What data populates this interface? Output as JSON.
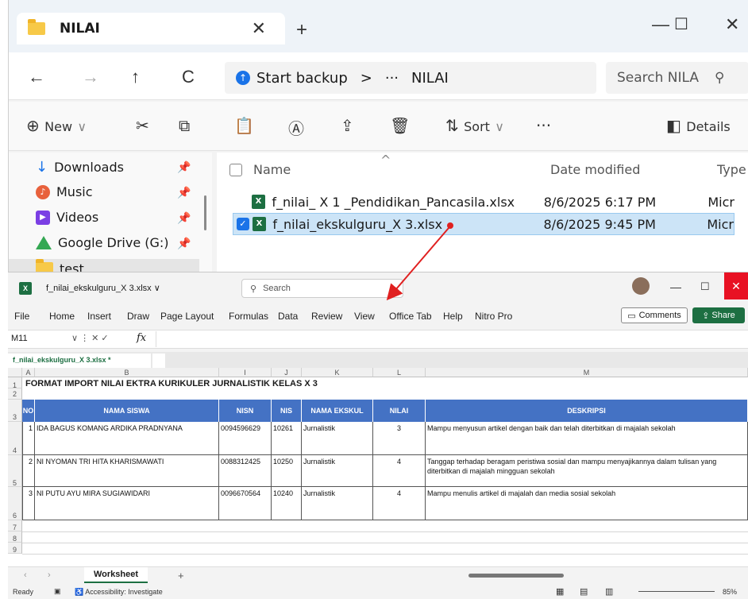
{
  "explorer": {
    "tab_title": "NILAI",
    "tab_close": "✕",
    "new_tab": "+",
    "window_controls": {
      "minimize": "—",
      "maximize": "☐",
      "close": "✕"
    },
    "nav": {
      "back": "←",
      "forward": "→",
      "up": "↑",
      "refresh": "C"
    },
    "address": {
      "backup_label": "Start backup",
      "sep": ">",
      "more": "···",
      "folder": "NILAI"
    },
    "search": {
      "placeholder": "Search NILA",
      "icon": "search-icon"
    },
    "toolbar": {
      "new_label": "New",
      "sort_label": "Sort",
      "more": "···",
      "details_label": "Details"
    },
    "sidebar": {
      "items": [
        {
          "label": "Downloads",
          "icon": "download-icon"
        },
        {
          "label": "Music",
          "icon": "music-icon"
        },
        {
          "label": "Videos",
          "icon": "video-icon"
        },
        {
          "label": "Google Drive (G:)",
          "icon": "google-drive-icon"
        },
        {
          "label": "test",
          "icon": "folder-icon"
        }
      ]
    },
    "columns": {
      "name": "Name",
      "date": "Date modified",
      "type": "Type"
    },
    "files": [
      {
        "name": "f_nilai_ X 1 _Pendidikan_Pancasila.xlsx",
        "date": "8/6/2025 6:17 PM",
        "type": "Micr"
      },
      {
        "name": "f_nilai_ekskulguru_X 3.xlsx",
        "date": "8/6/2025 9:45 PM",
        "type": "Micr"
      }
    ]
  },
  "excel": {
    "file_title": "f_nilai_ekskulguru_X 3.xlsx ∨",
    "search_placeholder": "Search",
    "menu": [
      "File",
      "Home",
      "Insert",
      "Draw",
      "Page Layout",
      "Formulas",
      "Data",
      "Review",
      "View",
      "Office Tab",
      "Help",
      "Nitro Pro"
    ],
    "comments_label": "Comments",
    "share_label": "Share",
    "name_box": "M11",
    "fx": "fx",
    "doc_tab": "f_nilai_ekskulguru_X 3.xlsx *",
    "col_headers": [
      "A",
      "B",
      "I",
      "J",
      "K",
      "L",
      "M"
    ],
    "row_headers": [
      "1",
      "2",
      "3",
      "4",
      "5",
      "6",
      "7",
      "8",
      "9"
    ],
    "sheet_title": "FORMAT IMPORT NILAI EKTRA KURIKULER  JURNALISTIK  KELAS X 3",
    "table_headers": [
      "NO",
      "NAMA SISWA",
      "NISN",
      "NIS",
      "NAMA EKSKUL",
      "NILAI",
      "DESKRIPSI"
    ],
    "rows": [
      {
        "no": "1",
        "nama": "IDA BAGUS KOMANG ARDIKA PRADNYANA",
        "nisn": "0094596629",
        "nis": "10261",
        "ekskul": "Jurnalistik",
        "nilai": "3",
        "deskripsi": "Mampu menyusun artikel dengan baik dan telah diterbitkan di majalah sekolah"
      },
      {
        "no": "2",
        "nama": "NI NYOMAN TRI HITA KHARISMAWATI",
        "nisn": "0088312425",
        "nis": "10250",
        "ekskul": "Jurnalistik",
        "nilai": "4",
        "deskripsi": "Tanggap terhadap beragam peristiwa sosial dan mampu menyajikannya dalam tulisan yang diterbitkan di majalah mingguan sekolah"
      },
      {
        "no": "3",
        "nama": "NI PUTU AYU MIRA SUGIAWIDARI",
        "nisn": "0096670564",
        "nis": "10240",
        "ekskul": "Jurnalistik",
        "nilai": "4",
        "deskripsi": "Mampu menulis artikel di majalah dan media sosial sekolah"
      }
    ],
    "sheet_tab": "Worksheet",
    "add_sheet": "+",
    "status": {
      "ready": "Ready",
      "accessibility": "Accessibility: Investigate",
      "zoom": "85%"
    }
  }
}
